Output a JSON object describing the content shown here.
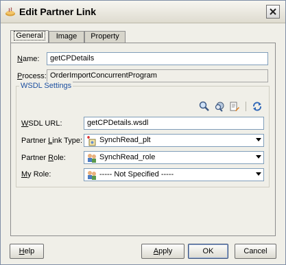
{
  "window": {
    "title": "Edit Partner Link"
  },
  "tabs": [
    {
      "label": "General",
      "active": true
    },
    {
      "label": "Image",
      "active": false
    },
    {
      "label": "Property",
      "active": false
    }
  ],
  "general": {
    "name_label_mnemonic": "N",
    "name_label_rest": "ame:",
    "name_value": "getCPDetails",
    "process_label_mnemonic": "P",
    "process_label_rest": "rocess:",
    "process_value": "OrderImportConcurrentProgram"
  },
  "wsdl": {
    "group_label": "WSDL Settings",
    "url_label_mnemonic": "W",
    "url_label_rest": "SDL URL:",
    "url_value": "getCPDetails.wsdl",
    "partner_link_type_label_pre": "Partner ",
    "partner_link_type_label_mnemonic": "L",
    "partner_link_type_label_rest": "ink Type:",
    "partner_link_type_value": "SynchRead_plt",
    "partner_role_label_pre": "Partner ",
    "partner_role_label_mnemonic": "R",
    "partner_role_label_rest": "ole:",
    "partner_role_value": "SynchRead_role",
    "my_role_label_mnemonic": "M",
    "my_role_label_rest": "y Role:",
    "my_role_value": "----- Not Specified -----"
  },
  "buttons": {
    "help_mnemonic": "H",
    "help_rest": "elp",
    "apply_pre": "",
    "apply_mnemonic": "A",
    "apply_rest": "pply",
    "ok_label": "OK",
    "cancel_label": "Cancel"
  },
  "icons": {
    "app": "bpel-partner-link-icon",
    "close": "close-icon",
    "find": "magnifier-icon",
    "browse_services": "service-explorer-icon",
    "wsdl_editor": "wsdl-edit-icon",
    "refresh": "refresh-icon",
    "partner_link_type": "partner-link-type-icon",
    "role": "role-icon"
  },
  "colors": {
    "group_label": "#1b4fa0",
    "default_button_border": "#38507a"
  }
}
